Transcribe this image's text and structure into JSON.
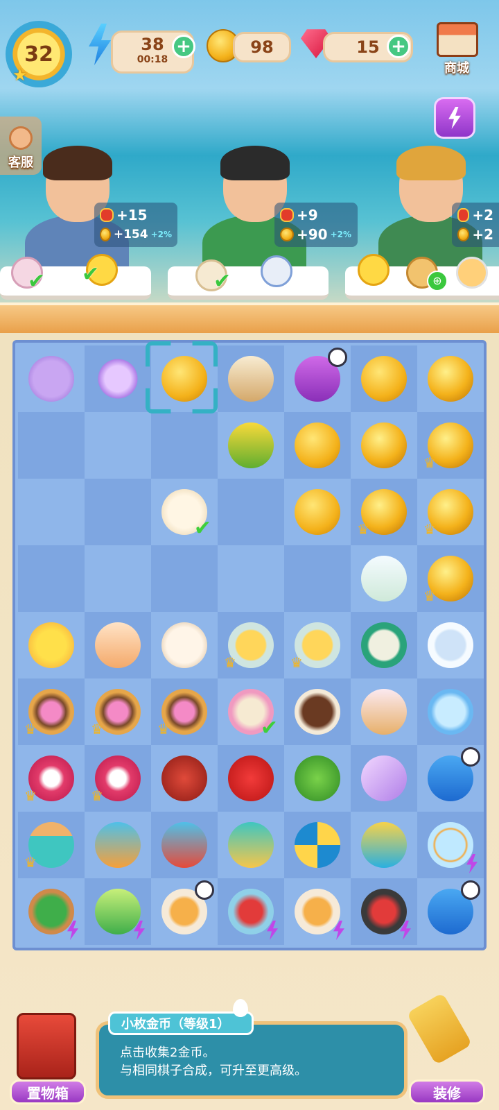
{
  "hud": {
    "level": "32",
    "energy": "38",
    "energy_timer": "00:18",
    "coins": "98",
    "gems": "15",
    "shop_label": "商城",
    "support_label": "客服"
  },
  "customers": [
    {
      "lantern_reward": "+15",
      "coin_reward": "+154",
      "coin_bonus": "+2%",
      "hair": "#4a2c1c",
      "shirt": "#5f84b8"
    },
    {
      "lantern_reward": "+9",
      "coin_reward": "+90",
      "coin_bonus": "+2%",
      "hair": "#2b2b2b",
      "shirt": "#3c9a50"
    },
    {
      "lantern_reward": "+2",
      "coin_reward": "+2",
      "coin_bonus": "",
      "hair": "#e0a53c",
      "shirt": "#3f8a52"
    }
  ],
  "board": {
    "rows": [
      [
        "flower-pot-icon",
        "flower-icon",
        "coin-icon",
        "wrap-icon",
        "chest-icon",
        "coins-stack-icon",
        "coins-pile-icon"
      ],
      [
        "",
        "",
        "",
        "corn-icon",
        "coins-stack-icon",
        "coins-pile-icon",
        "coins-pile-icon"
      ],
      [
        "",
        "",
        "roll-icon",
        "",
        "coin-icon",
        "coins-pile-icon",
        "coins-pile-icon"
      ],
      [
        "",
        "",
        "",
        "",
        "",
        "glass-icon",
        "coins-pile-icon"
      ],
      [
        "cake-icon",
        "dessert-icon",
        "bun-icon",
        "soup-icon",
        "soup-icon",
        "dumpling-bowl-icon",
        "empty-bowl-icon"
      ],
      [
        "icecream-bowl-icon",
        "icecream-bowl-icon",
        "icecream-bowl-icon",
        "pudding-icon",
        "choco-dessert-icon",
        "cone-icon",
        "ice-bowl-icon"
      ],
      [
        "dragonfruit-icon",
        "dragonfruit-icon",
        "pomegranate-icon",
        "strawberry-icon",
        "broccoli-icon",
        "crystal-icon",
        "fridge-icon"
      ],
      [
        "doghouse-icon",
        "petfood-icon",
        "cooking-pot-icon",
        "pet-house-icon",
        "ball-icon",
        "fries-icon",
        "fishbowl-icon"
      ],
      [
        "veg-basket-icon",
        "blender-icon",
        "soup-pot-icon",
        "cherry-basket-icon",
        "soup-pot-icon",
        "cherry-pan-icon",
        "fridge-icon"
      ]
    ]
  },
  "info": {
    "title": "小枚金币（等级1）",
    "line1": "点击收集2金币。",
    "line2": "与相同棋子合成，可升至更高级。"
  },
  "bottom": {
    "storage_label": "置物箱",
    "decorate_label": "装修"
  }
}
